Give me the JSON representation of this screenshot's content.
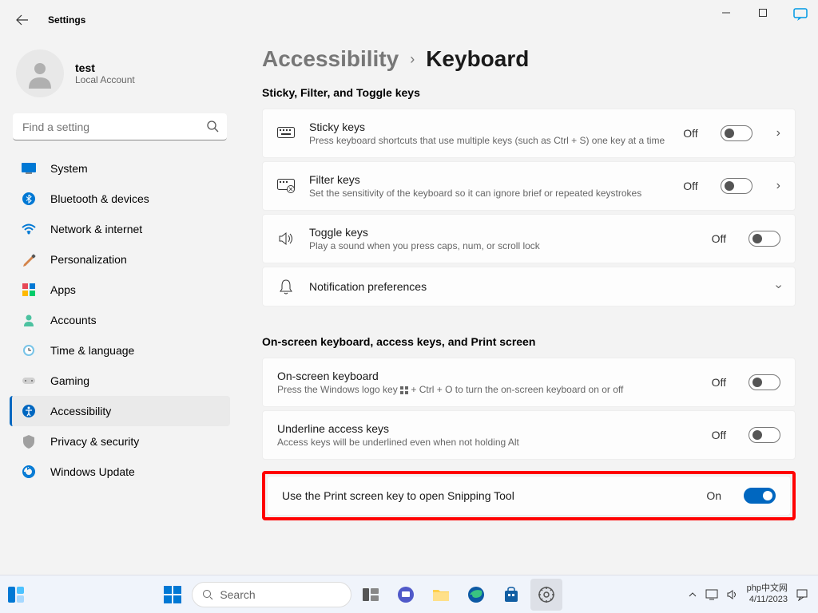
{
  "app": {
    "title": "Settings"
  },
  "user": {
    "name": "test",
    "account_type": "Local Account"
  },
  "search": {
    "placeholder": "Find a setting"
  },
  "nav": {
    "items": [
      {
        "label": "System"
      },
      {
        "label": "Bluetooth & devices"
      },
      {
        "label": "Network & internet"
      },
      {
        "label": "Personalization"
      },
      {
        "label": "Apps"
      },
      {
        "label": "Accounts"
      },
      {
        "label": "Time & language"
      },
      {
        "label": "Gaming"
      },
      {
        "label": "Accessibility"
      },
      {
        "label": "Privacy & security"
      },
      {
        "label": "Windows Update"
      }
    ]
  },
  "breadcrumb": {
    "parent": "Accessibility",
    "current": "Keyboard"
  },
  "section1": {
    "heading": "Sticky, Filter, and Toggle keys",
    "sticky": {
      "title": "Sticky keys",
      "desc": "Press keyboard shortcuts that use multiple keys (such as Ctrl + S) one key at a time",
      "status": "Off"
    },
    "filter": {
      "title": "Filter keys",
      "desc": "Set the sensitivity of the keyboard so it can ignore brief or repeated keystrokes",
      "status": "Off"
    },
    "toggle": {
      "title": "Toggle keys",
      "desc": "Play a sound when you press caps, num, or scroll lock",
      "status": "Off"
    },
    "notification": {
      "title": "Notification preferences"
    }
  },
  "section2": {
    "heading": "On-screen keyboard, access keys, and Print screen",
    "osk": {
      "title": "On-screen keyboard",
      "desc_pre": "Press the Windows logo key ",
      "desc_post": " + Ctrl + O to turn the on-screen keyboard on or off",
      "status": "Off"
    },
    "underline": {
      "title": "Underline access keys",
      "desc": "Access keys will be underlined even when not holding Alt",
      "status": "Off"
    },
    "printscreen": {
      "title": "Use the Print screen key to open Snipping Tool",
      "status": "On"
    }
  },
  "taskbar": {
    "search_placeholder": "Search",
    "time": "php中文网",
    "date": "4/11/2023"
  }
}
